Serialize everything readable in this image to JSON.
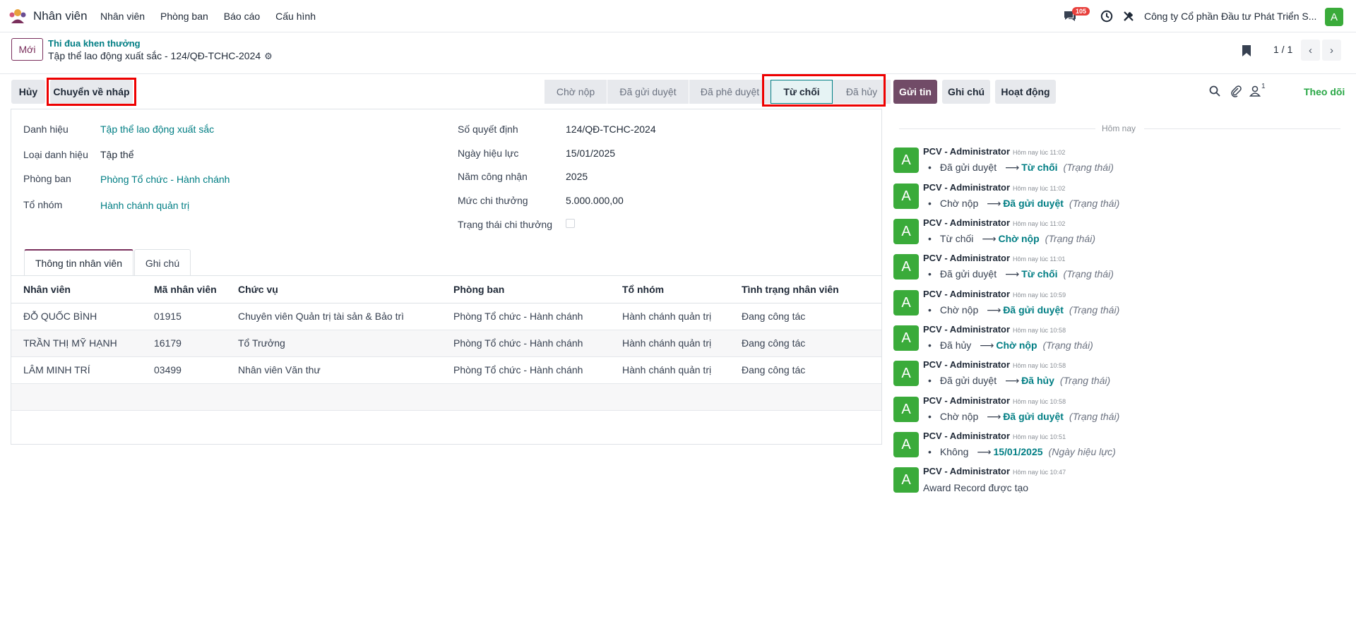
{
  "navbar": {
    "app_name": "Nhân viên",
    "menu": [
      "Nhân viên",
      "Phòng ban",
      "Báo cáo",
      "Cấu hình"
    ],
    "chat_badge": "105",
    "company": "Công ty Cổ phần Đầu tư Phát Triển S...",
    "user_initial": "A"
  },
  "control": {
    "new_label": "Mới",
    "breadcrumb_parent": "Thi đua khen thưởng",
    "breadcrumb_current": "Tập thể lao động xuất sắc - 124/QĐ-TCHC-2024",
    "pager": "1 / 1"
  },
  "statusbar": {
    "cancel_label": "Hủy",
    "draft_label": "Chuyển về nháp",
    "stages": [
      "Chờ nộp",
      "Đã gửi duyệt",
      "Đã phê duyệt",
      "Từ chối",
      "Đã hủy"
    ],
    "active_stage": "Từ chối"
  },
  "chatter_buttons": {
    "send": "Gửi tin",
    "note": "Ghi chú",
    "activity": "Hoạt động",
    "followers_count": "1",
    "follow": "Theo dõi"
  },
  "form": {
    "left": [
      {
        "label": "Danh hiệu",
        "value": "Tập thể lao động xuất sắc"
      },
      {
        "label": "Loại danh hiệu",
        "value": "Tập thể"
      },
      {
        "label": "Phòng ban",
        "value": "Phòng Tổ chức - Hành chánh"
      },
      {
        "label": "Tổ nhóm",
        "value": "Hành chánh quản trị"
      }
    ],
    "right": [
      {
        "label": "Số quyết định",
        "value": "124/QĐ-TCHC-2024"
      },
      {
        "label": "Ngày hiệu lực",
        "value": "15/01/2025"
      },
      {
        "label": "Năm công nhận",
        "value": "2025"
      },
      {
        "label": "Mức chi thưởng",
        "value": "5.000.000,00"
      },
      {
        "label": "Trạng thái chi thưởng",
        "value": ""
      }
    ],
    "tabs": [
      "Thông tin nhân viên",
      "Ghi chú"
    ]
  },
  "table": {
    "headers": [
      "Nhân viên",
      "Mã nhân viên",
      "Chức vụ",
      "Phòng ban",
      "Tổ nhóm",
      "Tình trạng nhân viên"
    ],
    "rows": [
      [
        "ĐỖ QUỐC BÌNH",
        "01915",
        "Chuyên viên Quản trị tài sản & Bảo trì",
        "Phòng Tổ chức - Hành chánh",
        "Hành chánh quản trị",
        "Đang công tác"
      ],
      [
        "TRẦN THỊ MỸ HẠNH",
        "16179",
        "Tổ Trưởng",
        "Phòng Tổ chức - Hành chánh",
        "Hành chánh quản trị",
        "Đang công tác"
      ],
      [
        "LÂM MINH TRÍ",
        "03499",
        "Nhân viên Văn thư",
        "Phòng Tổ chức - Hành chánh",
        "Hành chánh quản trị",
        "Đang công tác"
      ]
    ]
  },
  "chatter": {
    "today_label": "Hôm nay",
    "messages": [
      {
        "author": "PCV - Administrator",
        "time": "Hôm nay lúc 11:02",
        "old": "Đã gửi duyệt",
        "new": "Từ chối",
        "field": "(Trạng thái)"
      },
      {
        "author": "PCV - Administrator",
        "time": "Hôm nay lúc 11:02",
        "old": "Chờ nộp",
        "new": "Đã gửi duyệt",
        "field": "(Trạng thái)"
      },
      {
        "author": "PCV - Administrator",
        "time": "Hôm nay lúc 11:02",
        "old": "Từ chối",
        "new": "Chờ nộp",
        "field": "(Trạng thái)"
      },
      {
        "author": "PCV - Administrator",
        "time": "Hôm nay lúc 11:01",
        "old": "Đã gửi duyệt",
        "new": "Từ chối",
        "field": "(Trạng thái)"
      },
      {
        "author": "PCV - Administrator",
        "time": "Hôm nay lúc 10:59",
        "old": "Chờ nộp",
        "new": "Đã gửi duyệt",
        "field": "(Trạng thái)"
      },
      {
        "author": "PCV - Administrator",
        "time": "Hôm nay lúc 10:58",
        "old": "Đã hủy",
        "new": "Chờ nộp",
        "field": "(Trạng thái)"
      },
      {
        "author": "PCV - Administrator",
        "time": "Hôm nay lúc 10:58",
        "old": "Đã gửi duyệt",
        "new": "Đã hủy",
        "field": "(Trạng thái)"
      },
      {
        "author": "PCV - Administrator",
        "time": "Hôm nay lúc 10:58",
        "old": "Chờ nộp",
        "new": "Đã gửi duyệt",
        "field": "(Trạng thái)"
      },
      {
        "author": "PCV - Administrator",
        "time": "Hôm nay lúc 10:51",
        "old": "Không",
        "new": "15/01/2025",
        "field": "(Ngày hiệu lực)"
      },
      {
        "author": "PCV - Administrator",
        "time": "Hôm nay lúc 10:47",
        "text": "Award Record được tạo"
      }
    ]
  },
  "colors": {
    "brand": "#7a2f5c",
    "link": "#017e84",
    "avatar": "#3aab3a",
    "highlight": "#e00000"
  }
}
